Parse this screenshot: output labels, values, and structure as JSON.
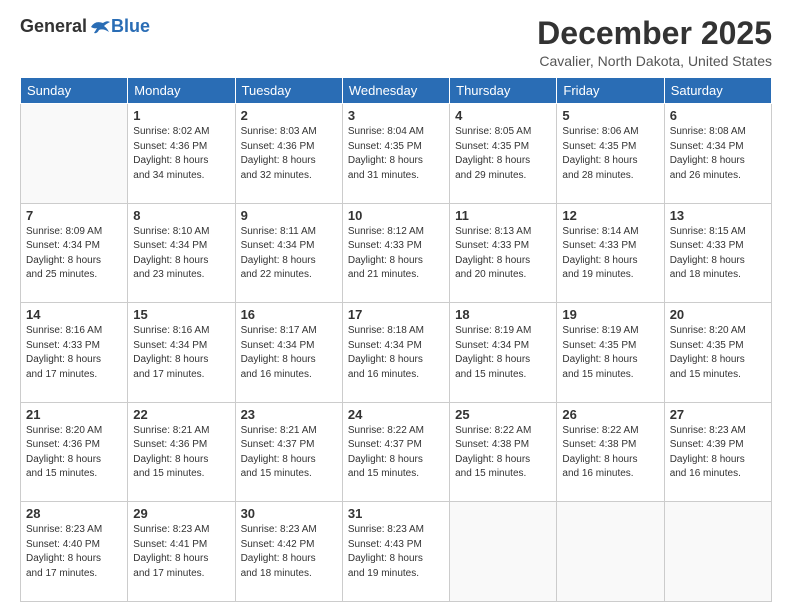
{
  "header": {
    "logo_general": "General",
    "logo_blue": "Blue",
    "month_title": "December 2025",
    "location": "Cavalier, North Dakota, United States"
  },
  "weekdays": [
    "Sunday",
    "Monday",
    "Tuesday",
    "Wednesday",
    "Thursday",
    "Friday",
    "Saturday"
  ],
  "weeks": [
    [
      {
        "day": "",
        "info": ""
      },
      {
        "day": "1",
        "info": "Sunrise: 8:02 AM\nSunset: 4:36 PM\nDaylight: 8 hours\nand 34 minutes."
      },
      {
        "day": "2",
        "info": "Sunrise: 8:03 AM\nSunset: 4:36 PM\nDaylight: 8 hours\nand 32 minutes."
      },
      {
        "day": "3",
        "info": "Sunrise: 8:04 AM\nSunset: 4:35 PM\nDaylight: 8 hours\nand 31 minutes."
      },
      {
        "day": "4",
        "info": "Sunrise: 8:05 AM\nSunset: 4:35 PM\nDaylight: 8 hours\nand 29 minutes."
      },
      {
        "day": "5",
        "info": "Sunrise: 8:06 AM\nSunset: 4:35 PM\nDaylight: 8 hours\nand 28 minutes."
      },
      {
        "day": "6",
        "info": "Sunrise: 8:08 AM\nSunset: 4:34 PM\nDaylight: 8 hours\nand 26 minutes."
      }
    ],
    [
      {
        "day": "7",
        "info": "Sunrise: 8:09 AM\nSunset: 4:34 PM\nDaylight: 8 hours\nand 25 minutes."
      },
      {
        "day": "8",
        "info": "Sunrise: 8:10 AM\nSunset: 4:34 PM\nDaylight: 8 hours\nand 23 minutes."
      },
      {
        "day": "9",
        "info": "Sunrise: 8:11 AM\nSunset: 4:34 PM\nDaylight: 8 hours\nand 22 minutes."
      },
      {
        "day": "10",
        "info": "Sunrise: 8:12 AM\nSunset: 4:33 PM\nDaylight: 8 hours\nand 21 minutes."
      },
      {
        "day": "11",
        "info": "Sunrise: 8:13 AM\nSunset: 4:33 PM\nDaylight: 8 hours\nand 20 minutes."
      },
      {
        "day": "12",
        "info": "Sunrise: 8:14 AM\nSunset: 4:33 PM\nDaylight: 8 hours\nand 19 minutes."
      },
      {
        "day": "13",
        "info": "Sunrise: 8:15 AM\nSunset: 4:33 PM\nDaylight: 8 hours\nand 18 minutes."
      }
    ],
    [
      {
        "day": "14",
        "info": "Sunrise: 8:16 AM\nSunset: 4:33 PM\nDaylight: 8 hours\nand 17 minutes."
      },
      {
        "day": "15",
        "info": "Sunrise: 8:16 AM\nSunset: 4:34 PM\nDaylight: 8 hours\nand 17 minutes."
      },
      {
        "day": "16",
        "info": "Sunrise: 8:17 AM\nSunset: 4:34 PM\nDaylight: 8 hours\nand 16 minutes."
      },
      {
        "day": "17",
        "info": "Sunrise: 8:18 AM\nSunset: 4:34 PM\nDaylight: 8 hours\nand 16 minutes."
      },
      {
        "day": "18",
        "info": "Sunrise: 8:19 AM\nSunset: 4:34 PM\nDaylight: 8 hours\nand 15 minutes."
      },
      {
        "day": "19",
        "info": "Sunrise: 8:19 AM\nSunset: 4:35 PM\nDaylight: 8 hours\nand 15 minutes."
      },
      {
        "day": "20",
        "info": "Sunrise: 8:20 AM\nSunset: 4:35 PM\nDaylight: 8 hours\nand 15 minutes."
      }
    ],
    [
      {
        "day": "21",
        "info": "Sunrise: 8:20 AM\nSunset: 4:36 PM\nDaylight: 8 hours\nand 15 minutes."
      },
      {
        "day": "22",
        "info": "Sunrise: 8:21 AM\nSunset: 4:36 PM\nDaylight: 8 hours\nand 15 minutes."
      },
      {
        "day": "23",
        "info": "Sunrise: 8:21 AM\nSunset: 4:37 PM\nDaylight: 8 hours\nand 15 minutes."
      },
      {
        "day": "24",
        "info": "Sunrise: 8:22 AM\nSunset: 4:37 PM\nDaylight: 8 hours\nand 15 minutes."
      },
      {
        "day": "25",
        "info": "Sunrise: 8:22 AM\nSunset: 4:38 PM\nDaylight: 8 hours\nand 15 minutes."
      },
      {
        "day": "26",
        "info": "Sunrise: 8:22 AM\nSunset: 4:38 PM\nDaylight: 8 hours\nand 16 minutes."
      },
      {
        "day": "27",
        "info": "Sunrise: 8:23 AM\nSunset: 4:39 PM\nDaylight: 8 hours\nand 16 minutes."
      }
    ],
    [
      {
        "day": "28",
        "info": "Sunrise: 8:23 AM\nSunset: 4:40 PM\nDaylight: 8 hours\nand 17 minutes."
      },
      {
        "day": "29",
        "info": "Sunrise: 8:23 AM\nSunset: 4:41 PM\nDaylight: 8 hours\nand 17 minutes."
      },
      {
        "day": "30",
        "info": "Sunrise: 8:23 AM\nSunset: 4:42 PM\nDaylight: 8 hours\nand 18 minutes."
      },
      {
        "day": "31",
        "info": "Sunrise: 8:23 AM\nSunset: 4:43 PM\nDaylight: 8 hours\nand 19 minutes."
      },
      {
        "day": "",
        "info": ""
      },
      {
        "day": "",
        "info": ""
      },
      {
        "day": "",
        "info": ""
      }
    ]
  ]
}
